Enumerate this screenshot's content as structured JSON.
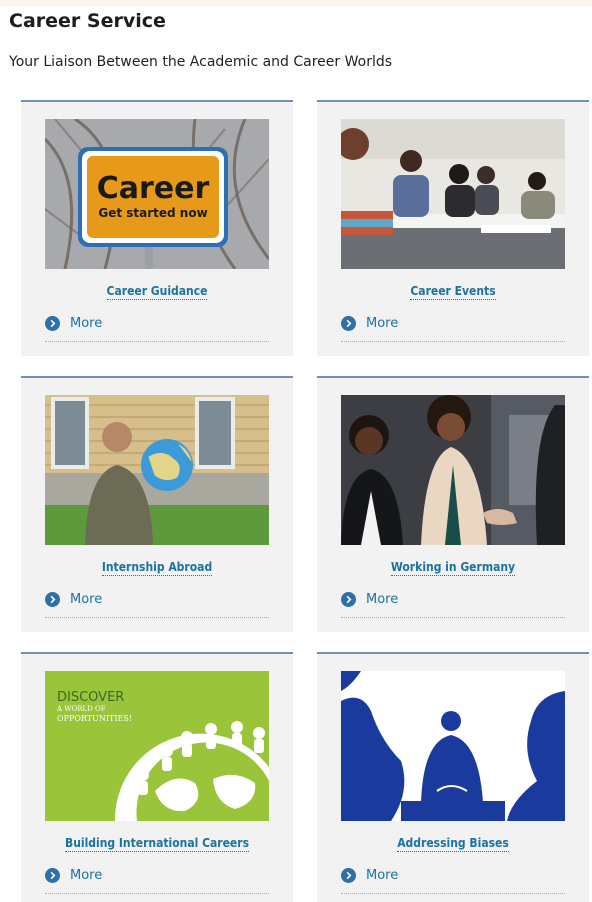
{
  "page": {
    "title": "Career Service",
    "subtitle": "Your Liaison Between the Academic and Career Worlds"
  },
  "cards": [
    {
      "title": "Career Guidance",
      "more_label": "More",
      "image": {
        "sign_line1": "Career",
        "sign_line2": "Get started now"
      }
    },
    {
      "title": "Career Events",
      "more_label": "More"
    },
    {
      "title": "Internship Abroad",
      "more_label": "More"
    },
    {
      "title": "Working in Germany",
      "more_label": "More"
    },
    {
      "title": "Building International Careers",
      "more_label": "More",
      "image": {
        "line1": "DISCOVER",
        "line2": "A WORLD OF",
        "line3": "OPPORTUNITIES!"
      }
    },
    {
      "title": "Addressing Biases",
      "more_label": "More"
    }
  ],
  "colors": {
    "link": "#1b73a2",
    "card_bg": "#f2f2f2",
    "card_border": "#6f8fbd",
    "green_tile": "#9ac43a",
    "blue_tile": "#1a3a9e"
  },
  "icons": {
    "more": "circle-arrow-right-icon"
  }
}
